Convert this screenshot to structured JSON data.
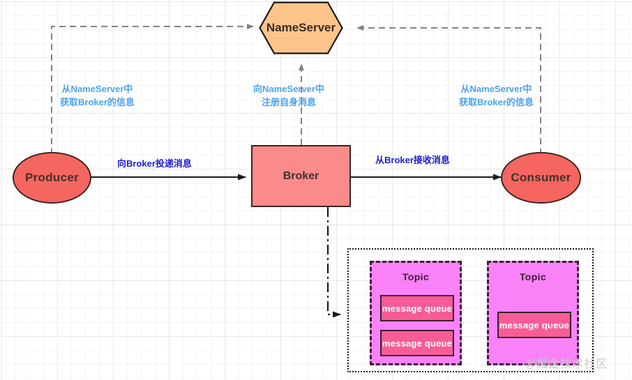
{
  "diagram": {
    "title": "RocketMQ architecture diagram",
    "nodes": {
      "nameserver": {
        "label": "NameServer",
        "shape": "hexagon",
        "fill": "#fcc48a",
        "stroke": "#1a1a1a"
      },
      "producer": {
        "label": "Producer",
        "shape": "ellipse",
        "fill": "#f4665f",
        "stroke": "#3b2320"
      },
      "broker": {
        "label": "Broker",
        "shape": "rectangle",
        "fill": "#fb8b8b",
        "stroke": "#3b2320"
      },
      "consumer": {
        "label": "Consumer",
        "shape": "ellipse",
        "fill": "#f4665f",
        "stroke": "#3b2320"
      }
    },
    "edge_labels": {
      "producer_to_nameserver": {
        "line1": "从NameServer中",
        "line2": "获取Broker的信息",
        "color": "#4aa3f0"
      },
      "broker_to_nameserver": {
        "line1": "向NameServer中",
        "line2": "注册自身消息",
        "color": "#4aa3f0"
      },
      "consumer_to_nameserver": {
        "line1": "从NameServer中",
        "line2": "获取Broker的信息",
        "color": "#4aa3f0"
      },
      "producer_to_broker": {
        "text": "向Broker投递消息",
        "color": "#1b1bd4"
      },
      "broker_to_consumer": {
        "text": "从Broker接收消息",
        "color": "#1b1bd4"
      }
    },
    "topics": [
      {
        "label": "Topic",
        "fill": "#f982f9",
        "stroke": "#3a2030",
        "queues": [
          {
            "label": "message queue",
            "fill": "#f75c96"
          },
          {
            "label": "message queue",
            "fill": "#f75c96"
          }
        ]
      },
      {
        "label": "Topic",
        "fill": "#f982f9",
        "stroke": "#3a2030",
        "queues": [
          {
            "label": "message queue",
            "fill": "#f75c96"
          }
        ]
      }
    ],
    "watermark": "@掘金技术社区"
  }
}
